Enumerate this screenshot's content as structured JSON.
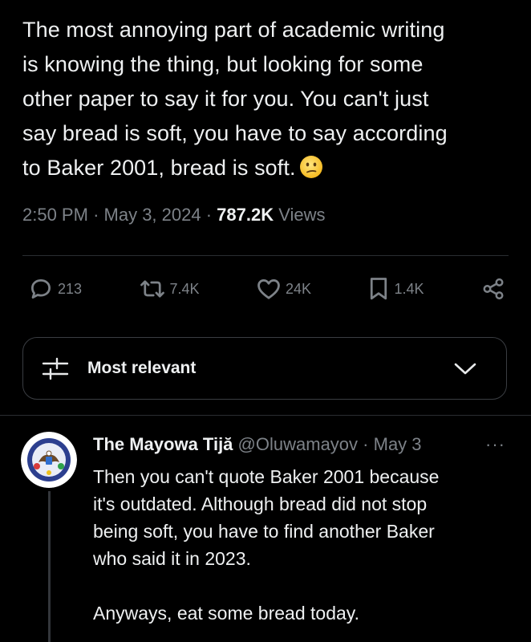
{
  "tweet": {
    "text_lines": [
      "The most annoying part of academic writing",
      "is knowing the thing, but looking for some",
      "other paper to say it for you. You can't just",
      "say bread is soft, you have to say according",
      "to Baker 2001, bread is soft."
    ],
    "emoji": "confused-face-emoji",
    "time": "2:50 PM",
    "date": "May 3, 2024",
    "separator": "·",
    "views_count": "787.2K",
    "views_label": "Views"
  },
  "actions": {
    "replies": "213",
    "reposts": "7.4K",
    "likes": "24K",
    "bookmarks": "1.4K"
  },
  "sort": {
    "label": "Most relevant"
  },
  "reply": {
    "display_name": "The Mayowa Tijă",
    "handle": "@Oluwamayov",
    "date": "May 3",
    "more": "···",
    "body_lines": [
      "Then you can't quote Baker 2001 because",
      "it's outdated. Although bread did not stop",
      "being soft, you have to find another Baker",
      "who said it in 2023."
    ],
    "closing_line": "Anyways, eat some bread today."
  },
  "colors": {
    "background": "#000000",
    "text": "#eef0f1",
    "muted": "#7d8288",
    "divider": "#2a2d31"
  }
}
